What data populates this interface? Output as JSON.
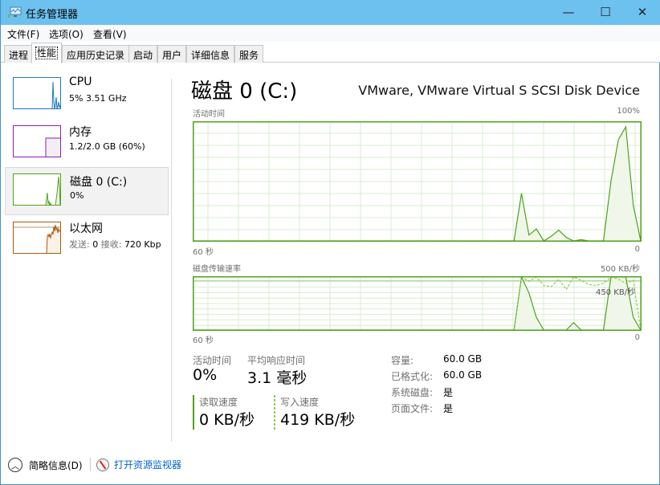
{
  "window": {
    "title": "任务管理器",
    "controls": {
      "minimize": "—",
      "maximize": "☐",
      "close": "✕"
    }
  },
  "menu": [
    "文件(F)",
    "选项(O)",
    "查看(V)"
  ],
  "tabs": [
    {
      "label": "进程",
      "active": false
    },
    {
      "label": "性能",
      "active": true
    },
    {
      "label": "应用历史记录",
      "active": false
    },
    {
      "label": "启动",
      "active": false
    },
    {
      "label": "用户",
      "active": false
    },
    {
      "label": "详细信息",
      "active": false
    },
    {
      "label": "服务",
      "active": false
    }
  ],
  "sidebar": [
    {
      "name": "CPU",
      "sub": "5% 3.51 GHz",
      "color": "#1a7ab8",
      "fill": "#eaf3fa",
      "selected": false
    },
    {
      "name": "内存",
      "sub": "1.2/2.0 GB (60%)",
      "color": "#8b1fad",
      "fill": "#f2eef4",
      "selected": false,
      "usage_fraction": 0.6
    },
    {
      "name": "磁盘 0 (C:)",
      "sub": "0%",
      "color": "#4ea21a",
      "fill": "#eef6e8",
      "selected": true
    },
    {
      "name": "以太网",
      "sub_label_send": "发送:",
      "sub_value_send": "0",
      "sub_label_recv": "接收:",
      "sub_value_recv": "720 Kbp",
      "color": "#a75a12",
      "fill": "#fcf1e6",
      "selected": false
    }
  ],
  "main": {
    "title": "磁盘 0 (C:)",
    "device": "VMware, VMware Virtual S SCSI Disk Device",
    "accent": "#4ea21a",
    "grid_color": "#d9ecd0",
    "fill_color": "#eef6e8"
  },
  "chart_data": [
    {
      "type": "area",
      "title": "活动时间",
      "ymax_label": "100%",
      "xmin_label": "60 秒",
      "xmax_label": "0",
      "xlim": [
        60,
        0
      ],
      "ylim": [
        0,
        100
      ],
      "x": [
        60,
        17,
        15,
        13,
        11,
        10,
        8,
        6,
        4,
        3,
        2,
        0.5,
        -1,
        -2,
        -4,
        -5,
        -7,
        -9,
        -11
      ],
      "series": [
        {
          "name": "活动时间",
          "x": [
            60,
            17,
            16,
            15,
            14,
            13,
            12,
            11,
            10,
            9,
            8,
            7,
            6,
            5,
            4,
            3,
            2,
            1,
            0
          ],
          "values": [
            0,
            0,
            40,
            5,
            10,
            0,
            4,
            9,
            3,
            0,
            1,
            0,
            0,
            0,
            50,
            85,
            96,
            30,
            0
          ]
        }
      ]
    },
    {
      "type": "area",
      "title": "磁盘传输速率",
      "ymax_label": "500 KB/秒",
      "reference_label": "450 KB/秒",
      "reference_value": 450,
      "xmin_label": "60 秒",
      "xmax_label": "0",
      "xlim": [
        60,
        0
      ],
      "ylim": [
        0,
        500
      ],
      "series": [
        {
          "name": "读取速度",
          "style": "solid",
          "x": [
            60,
            17,
            16,
            15,
            14,
            13,
            12,
            11,
            10,
            9,
            8,
            7,
            6,
            5,
            4,
            3,
            2,
            1,
            0
          ],
          "values": [
            0,
            0,
            500,
            350,
            120,
            0,
            0,
            0,
            0,
            70,
            0,
            0,
            0,
            0,
            500,
            500,
            500,
            120,
            0
          ]
        },
        {
          "name": "写入速度",
          "style": "dashed",
          "x": [
            60,
            17,
            16,
            15,
            14,
            13,
            12,
            11,
            10,
            9,
            8,
            7,
            6,
            5,
            4,
            3,
            2,
            1,
            0
          ],
          "values": [
            0,
            0,
            500,
            460,
            500,
            420,
            410,
            480,
            380,
            500,
            470,
            430,
            420,
            440,
            500,
            480,
            440,
            470,
            0
          ]
        }
      ]
    }
  ],
  "stats": {
    "active_time_label": "活动时间",
    "active_time_value": "0%",
    "avg_response_label": "平均响应时间",
    "avg_response_value": "3.1 毫秒",
    "read_label": "读取速度",
    "read_value": "0 KB/秒",
    "write_label": "写入速度",
    "write_value": "419 KB/秒"
  },
  "properties": [
    {
      "label": "容量:",
      "value": "60.0 GB"
    },
    {
      "label": "已格式化:",
      "value": "60.0 GB"
    },
    {
      "label": "系统磁盘:",
      "value": "是"
    },
    {
      "label": "页面文件:",
      "value": "是"
    }
  ],
  "footer": {
    "fewer_details": "简略信息(D)",
    "open_resmon": "打开资源监视器"
  }
}
